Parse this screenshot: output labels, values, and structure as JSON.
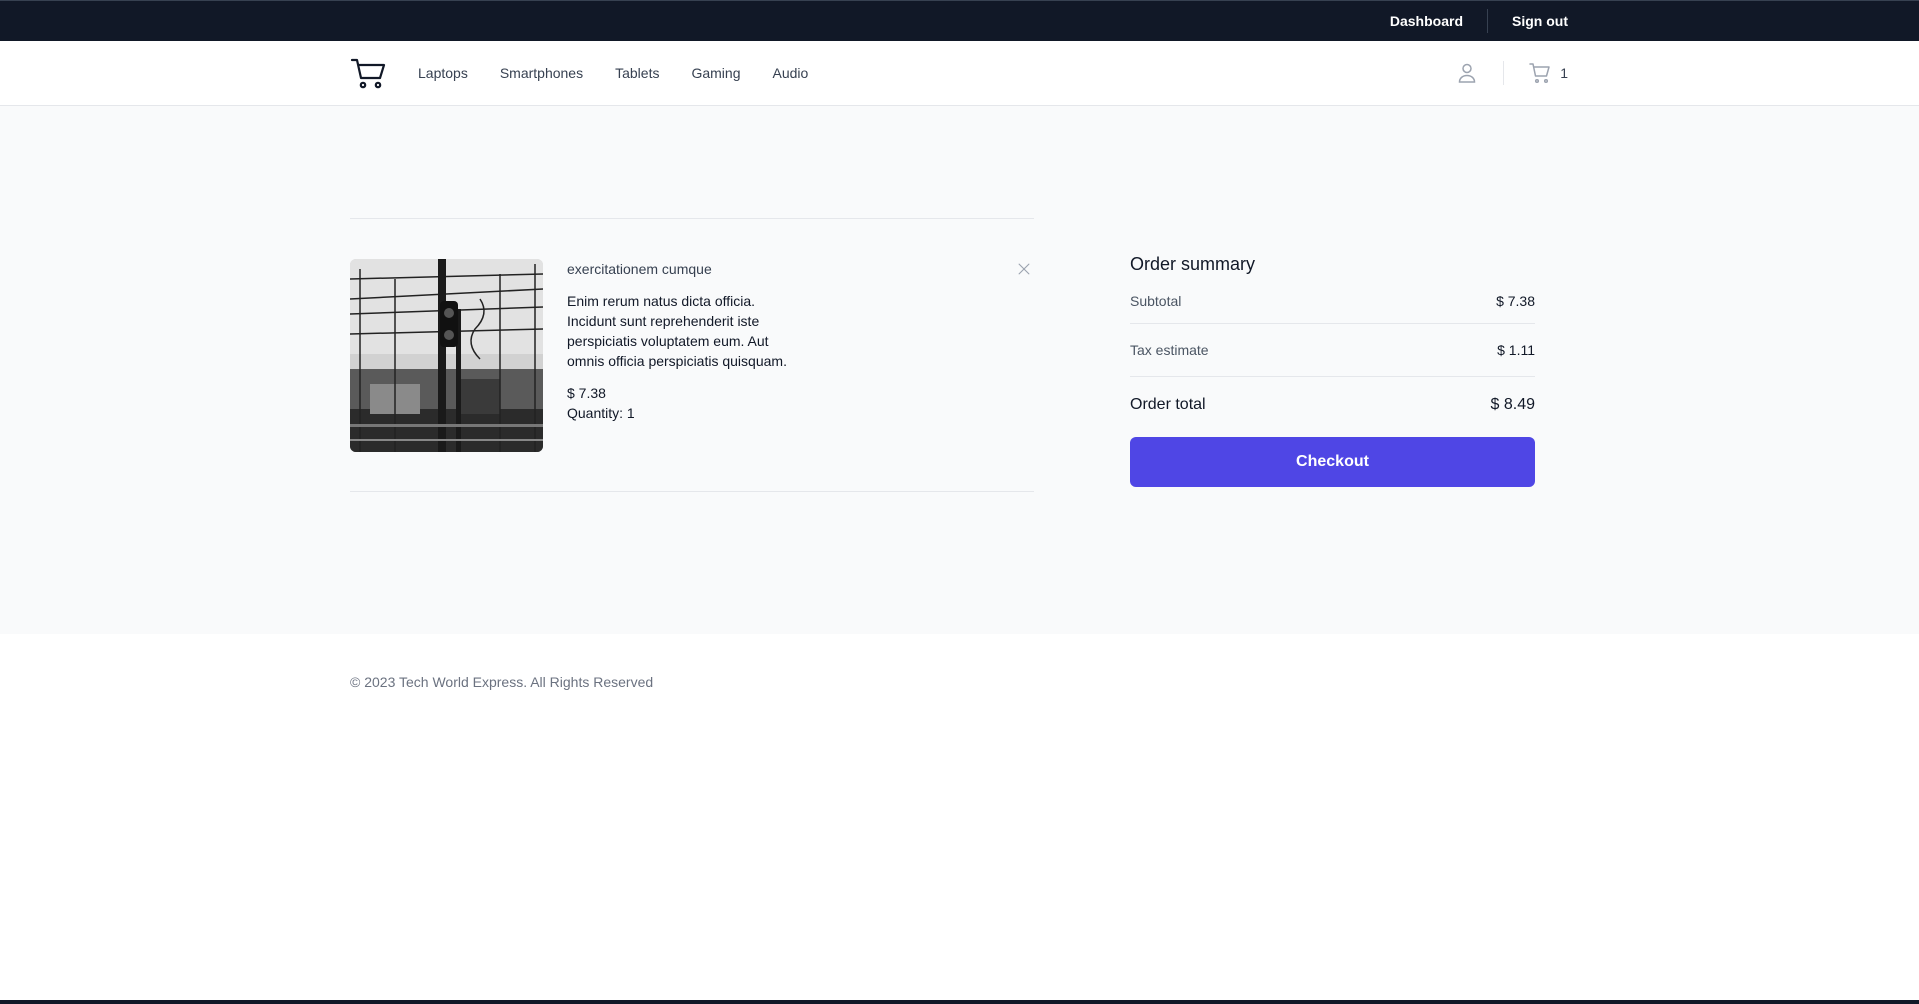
{
  "topbar": {
    "dashboard_label": "Dashboard",
    "signout_label": "Sign out"
  },
  "header": {
    "logo_icon": "shopping-cart-icon",
    "nav": [
      {
        "label": "Laptops"
      },
      {
        "label": "Smartphones"
      },
      {
        "label": "Tablets"
      },
      {
        "label": "Gaming"
      },
      {
        "label": "Audio"
      }
    ],
    "user_icon": "user-icon",
    "cart_icon": "cart-icon",
    "cart_count": "1"
  },
  "cart": {
    "items": [
      {
        "name": "exercitationem cumque",
        "description": "Enim rerum natus dicta officia. Incidunt sunt reprehenderit iste perspiciatis voluptatem eum. Aut omnis officia perspiciatis quisquam.",
        "price": "$ 7.38",
        "quantity": "Quantity: 1",
        "image": "railway-overhead-wires-photo",
        "remove_icon": "close-icon"
      }
    ]
  },
  "summary": {
    "title": "Order summary",
    "subtotal_label": "Subtotal",
    "subtotal_value": "$ 7.38",
    "tax_label": "Tax estimate",
    "tax_value": "$ 1.11",
    "total_label": "Order total",
    "total_value": "$ 8.49",
    "checkout_label": "Checkout"
  },
  "footer": {
    "copyright": "© 2023 Tech World Express. All Rights Reserved"
  },
  "colors": {
    "topbar_bg": "#111827",
    "accent": "#4f46e5",
    "page_bg": "#f9fafb"
  }
}
